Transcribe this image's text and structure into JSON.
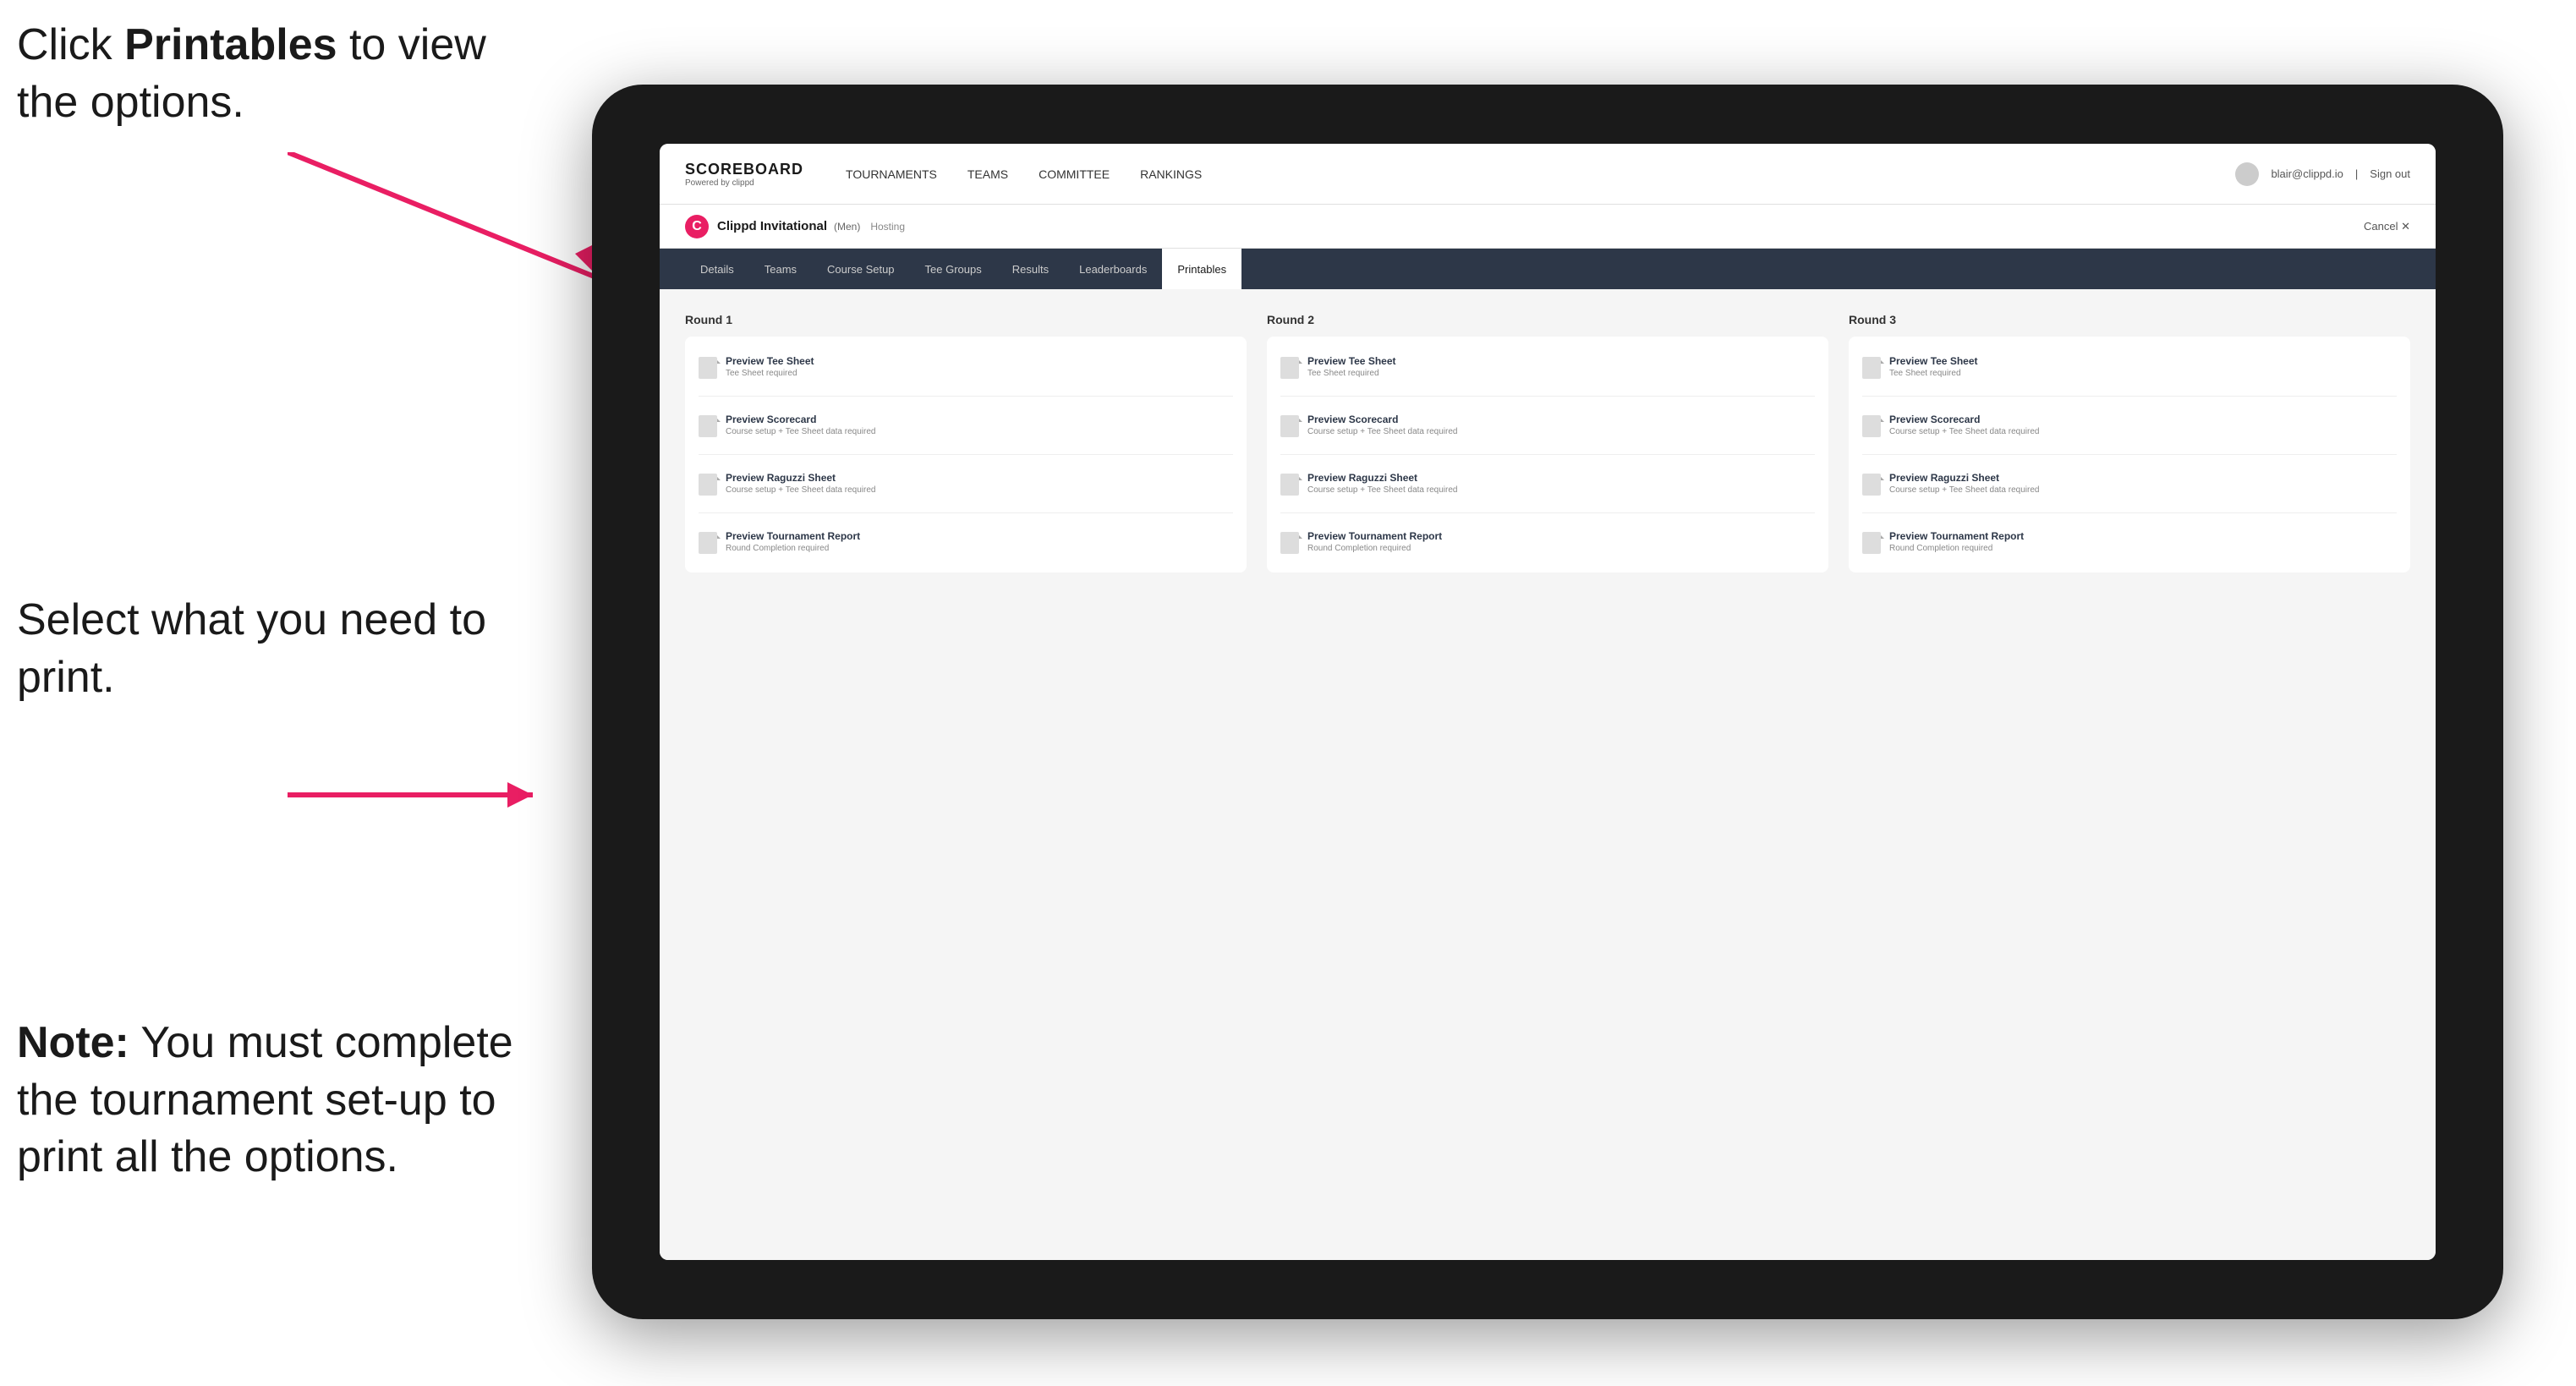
{
  "annotations": {
    "top": "Click Printables to view the options.",
    "top_bold": "Printables",
    "middle": "Select what you need to print.",
    "bottom_note_label": "Note:",
    "bottom_note_text": " You must complete the tournament set-up to print all the options."
  },
  "topnav": {
    "brand_title": "SCOREBOARD",
    "brand_sub": "Powered by clippd",
    "links": [
      {
        "label": "TOURNAMENTS",
        "active": false
      },
      {
        "label": "TEAMS",
        "active": false
      },
      {
        "label": "COMMITTEE",
        "active": false
      },
      {
        "label": "RANKINGS",
        "active": false
      }
    ],
    "user_email": "blair@clippd.io",
    "sign_out": "Sign out"
  },
  "subnav": {
    "logo_letter": "C",
    "tournament_name": "Clippd Invitational",
    "tournament_tag": "(Men)",
    "tournament_status": "Hosting",
    "cancel_label": "Cancel ✕"
  },
  "tabs": [
    {
      "label": "Details",
      "active": false
    },
    {
      "label": "Teams",
      "active": false
    },
    {
      "label": "Course Setup",
      "active": false
    },
    {
      "label": "Tee Groups",
      "active": false
    },
    {
      "label": "Results",
      "active": false
    },
    {
      "label": "Leaderboards",
      "active": false
    },
    {
      "label": "Printables",
      "active": true
    }
  ],
  "rounds": [
    {
      "title": "Round 1",
      "items": [
        {
          "title": "Preview Tee Sheet",
          "subtitle": "Tee Sheet required"
        },
        {
          "title": "Preview Scorecard",
          "subtitle": "Course setup + Tee Sheet data required"
        },
        {
          "title": "Preview Raguzzi Sheet",
          "subtitle": "Course setup + Tee Sheet data required"
        },
        {
          "title": "Preview Tournament Report",
          "subtitle": "Round Completion required"
        }
      ]
    },
    {
      "title": "Round 2",
      "items": [
        {
          "title": "Preview Tee Sheet",
          "subtitle": "Tee Sheet required"
        },
        {
          "title": "Preview Scorecard",
          "subtitle": "Course setup + Tee Sheet data required"
        },
        {
          "title": "Preview Raguzzi Sheet",
          "subtitle": "Course setup + Tee Sheet data required"
        },
        {
          "title": "Preview Tournament Report",
          "subtitle": "Round Completion required"
        }
      ]
    },
    {
      "title": "Round 3",
      "items": [
        {
          "title": "Preview Tee Sheet",
          "subtitle": "Tee Sheet required"
        },
        {
          "title": "Preview Scorecard",
          "subtitle": "Course setup + Tee Sheet data required"
        },
        {
          "title": "Preview Raguzzi Sheet",
          "subtitle": "Course setup + Tee Sheet data required"
        },
        {
          "title": "Preview Tournament Report",
          "subtitle": "Round Completion required"
        }
      ]
    }
  ]
}
